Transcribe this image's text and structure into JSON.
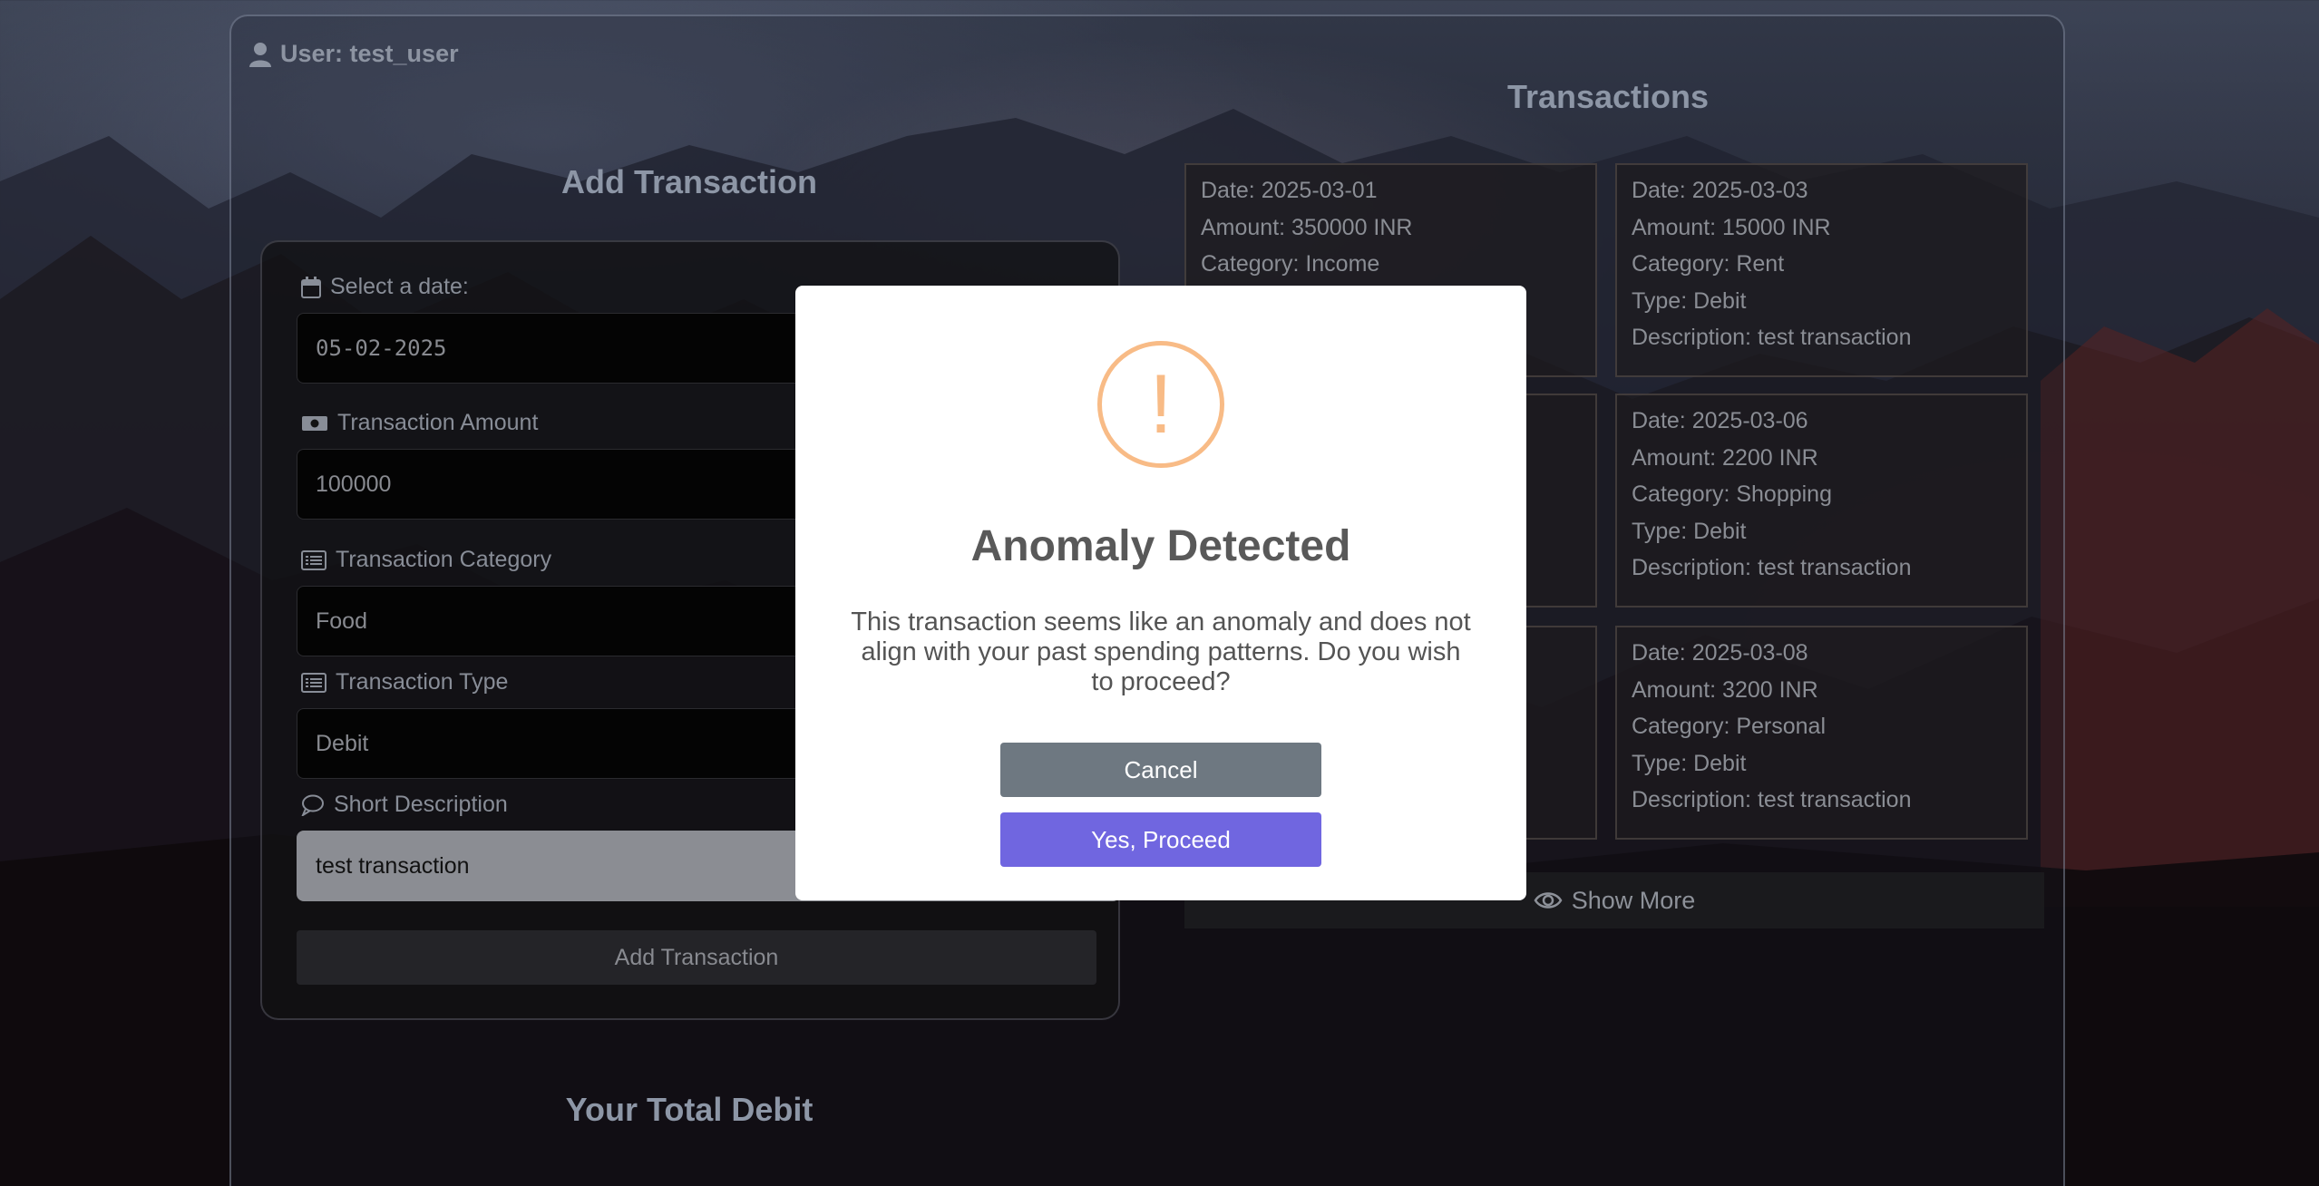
{
  "user": {
    "label": "User: test_user"
  },
  "form": {
    "title": "Add Transaction",
    "date_label": "Select a date:",
    "date_value": "05-02-2025",
    "amount_label": "Transaction Amount",
    "amount_value": "100000",
    "category_label": "Transaction Category",
    "category_value": "Food",
    "type_label": "Transaction Type",
    "type_value": "Debit",
    "description_label": "Short Description",
    "description_value": "test transaction",
    "submit_label": "Add Transaction"
  },
  "transactions": {
    "title": "Transactions",
    "cards": [
      {
        "date": "Date: 2025-03-01",
        "amount": "Amount: 350000 INR",
        "category": "Category: Income",
        "type": "",
        "description": ""
      },
      {
        "date": "Date: 2025-03-03",
        "amount": "Amount: 15000 INR",
        "category": "Category: Rent",
        "type": "Type: Debit",
        "description": "Description: test transaction"
      },
      {
        "date": "Date: 2025-03-06",
        "amount": "Amount: 2200 INR",
        "category": "Category: Shopping",
        "type": "Type: Debit",
        "description": "Description: test transaction"
      },
      {
        "date": "Date: 2025-03-08",
        "amount": "Amount: 3200 INR",
        "category": "Category: Personal",
        "type": "Type: Debit",
        "description": "Description: test transaction"
      }
    ],
    "show_more_label": "Show More"
  },
  "total_debit": {
    "title": "Your Total Debit"
  },
  "modal": {
    "icon_glyph": "!",
    "title": "Anomaly Detected",
    "message": "This transaction seems like an anomaly and does not align with your past spending patterns. Do you wish to proceed?",
    "cancel_label": "Cancel",
    "confirm_label": "Yes, Proceed"
  },
  "colors": {
    "warning": "#f8bb86",
    "confirm": "#7066e0",
    "cancel": "#6e7881"
  }
}
